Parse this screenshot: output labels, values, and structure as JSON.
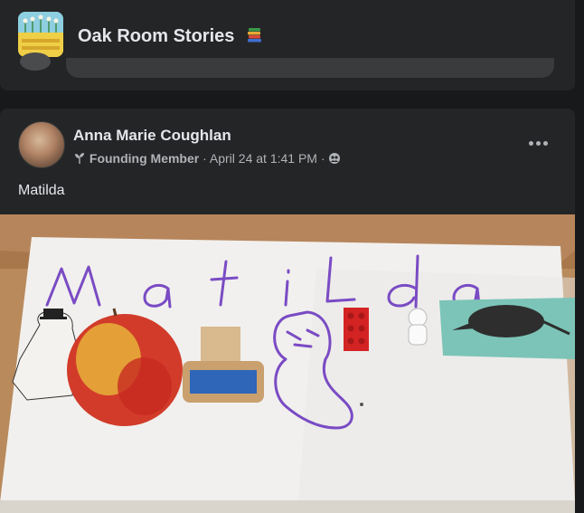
{
  "group": {
    "name": "Oak Room Stories",
    "icon": "books-icon",
    "avatar": "group-cover-image"
  },
  "post": {
    "author": "Anna Marie Coughlan",
    "badge_icon": "plant-icon",
    "badge": "Founding Member",
    "timestamp": "· April 24 at 1:41 PM ·",
    "audience_icon": "group-audience-icon",
    "text": "Matilda",
    "more_icon": "more-options-icon"
  },
  "photo": {
    "handwritten_letters": [
      "M",
      "a",
      "t",
      "i",
      "l",
      "d",
      "a"
    ],
    "objects": [
      "moomin-figure",
      "red-apple",
      "wooden-stamp",
      "drawn-face",
      "red-lego-brick",
      "white-figurine",
      "armadillo-card"
    ]
  },
  "colors": {
    "background": "#18191a",
    "surface": "#242526",
    "text_primary": "#e4e6eb",
    "text_secondary": "#b0b3b8",
    "marker_purple": "#7a4bc4"
  }
}
